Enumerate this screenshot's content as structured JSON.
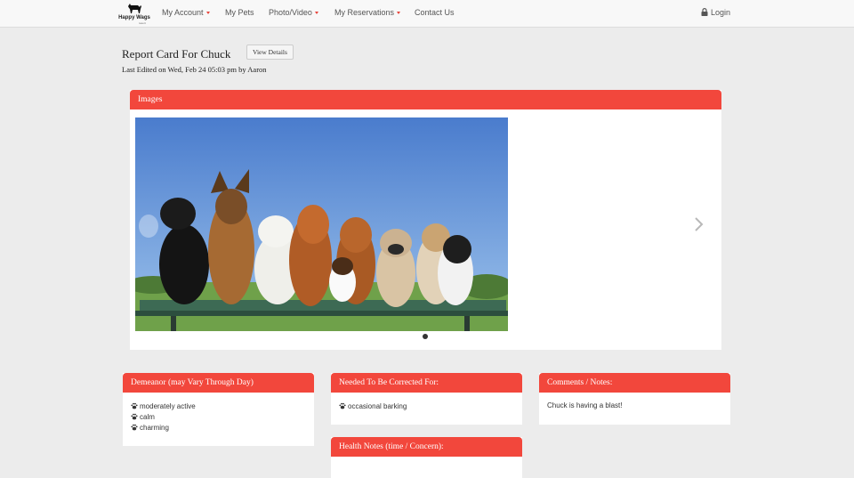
{
  "nav": {
    "logo_text": "Happy Wags",
    "logo_sub": "resort",
    "items": [
      {
        "label": "My Account",
        "dropdown": true
      },
      {
        "label": "My Pets",
        "dropdown": false
      },
      {
        "label": "Photo/Video",
        "dropdown": true
      },
      {
        "label": "My Reservations",
        "dropdown": true
      },
      {
        "label": "Contact Us",
        "dropdown": false
      }
    ],
    "login_label": "Login",
    "accent_color": "#e8453c"
  },
  "header": {
    "title": "Report Card For Chuck",
    "view_details_label": "View Details",
    "last_edited": "Last Edited on Wed, Feb 24 05:03 pm by Aaron"
  },
  "images_panel": {
    "title": "Images",
    "slide_count": 1,
    "active_slide": 1
  },
  "demeanor": {
    "title": "Demeanor (may Vary Through Day)",
    "items": [
      "moderately active",
      "calm",
      "charming"
    ]
  },
  "corrections": {
    "title": "Needed To Be Corrected For:",
    "items": [
      "occasional barking"
    ]
  },
  "comments": {
    "title": "Comments / Notes:",
    "text": "Chuck is having a blast!"
  },
  "health": {
    "title": "Health Notes (time / Concern):"
  },
  "colors": {
    "panel_header": "#f2473c",
    "background": "#ececec"
  }
}
